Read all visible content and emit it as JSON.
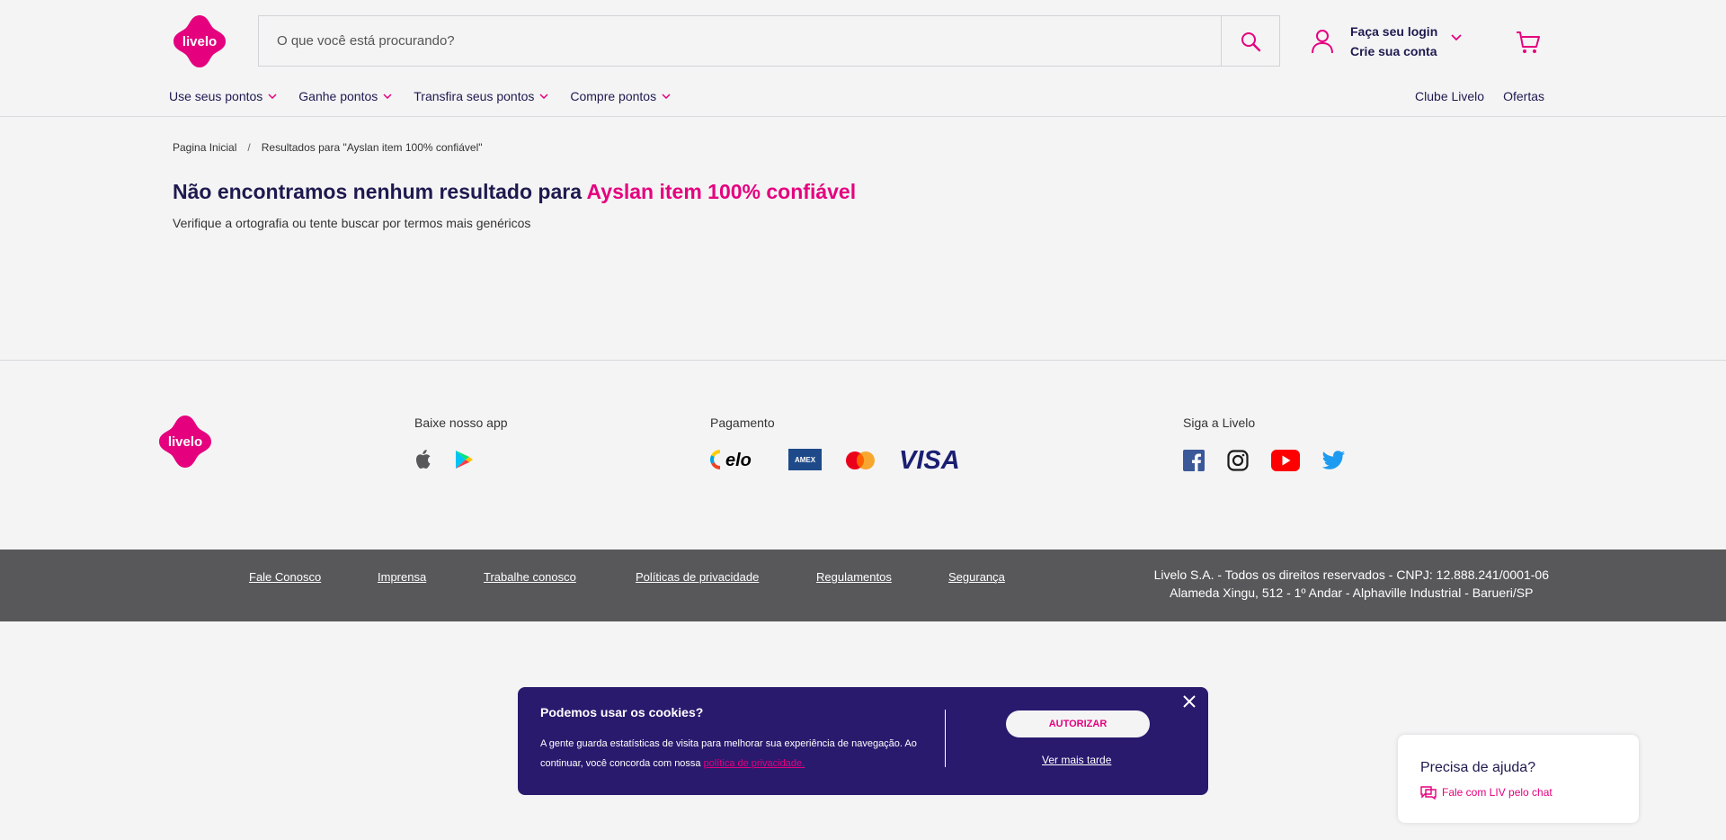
{
  "brand": {
    "name": "livelo",
    "accent": "#e5007e",
    "navy": "#1e1a4f"
  },
  "search": {
    "placeholder": "O que você está procurando?"
  },
  "account": {
    "login": "Faça seu login",
    "signup": "Crie sua conta"
  },
  "nav": {
    "items": [
      {
        "label": "Use seus pontos"
      },
      {
        "label": "Ganhe pontos"
      },
      {
        "label": "Transfira seus pontos"
      },
      {
        "label": "Compre pontos"
      }
    ],
    "right": [
      {
        "label": "Clube Livelo"
      },
      {
        "label": "Ofertas"
      }
    ]
  },
  "breadcrumb": {
    "home": "Pagina Inicial",
    "separator": "/",
    "current": "Resultados para \"Ayslan item 100% confiável\""
  },
  "results": {
    "title_prefix": "Não encontramos nenhum resultado para",
    "query": "Ayslan item 100% confiável",
    "hint": "Verifique a ortografia ou tente buscar por termos mais genéricos"
  },
  "footer": {
    "app_title": "Baixe nosso app",
    "payment_title": "Pagamento",
    "social_title": "Siga a Livelo",
    "payment_brands": [
      "elo",
      "AMEX",
      "mastercard",
      "VISA"
    ],
    "links": [
      {
        "label": "Fale Conosco"
      },
      {
        "label": "Imprensa"
      },
      {
        "label": "Trabalhe conosco"
      },
      {
        "label": "Políticas de privacidade"
      },
      {
        "label": "Regulamentos"
      },
      {
        "label": "Segurança"
      }
    ],
    "legal_line1": "Livelo S.A. - Todos os direitos reservados - CNPJ: 12.888.241/0001-06",
    "legal_line2": "Alameda Xingu, 512 - 1º Andar - Alphaville Industrial - Barueri/SP"
  },
  "cookie": {
    "title": "Podemos usar os cookies?",
    "text": "A gente guarda estatísticas de visita para melhorar sua experiência de navegação. Ao continuar, você concorda com nossa",
    "link": "política de privacidade.",
    "accept": "AUTORIZAR",
    "later": "Ver mais tarde"
  },
  "help": {
    "title": "Precisa de ajuda?",
    "chat": "Fale com LIV pelo chat"
  }
}
